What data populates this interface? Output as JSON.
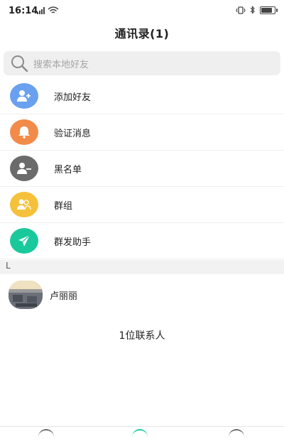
{
  "status_bar": {
    "time": "16:14"
  },
  "header": {
    "title": "通讯录(1)"
  },
  "search": {
    "placeholder": "搜索本地好友"
  },
  "menu": [
    {
      "label": "添加好友",
      "icon": "add-friend-icon",
      "color": "#6aa0f0"
    },
    {
      "label": "验证消息",
      "icon": "bell-icon",
      "color": "#f28b4a"
    },
    {
      "label": "黑名单",
      "icon": "blacklist-icon",
      "color": "#6b6b6b"
    },
    {
      "label": "群组",
      "icon": "group-icon",
      "color": "#f5c13b"
    },
    {
      "label": "群发助手",
      "icon": "send-icon",
      "color": "#19c99b"
    }
  ],
  "section_letter": "L",
  "contacts": [
    {
      "name": "卢丽丽"
    }
  ],
  "contact_count": "1位联系人"
}
